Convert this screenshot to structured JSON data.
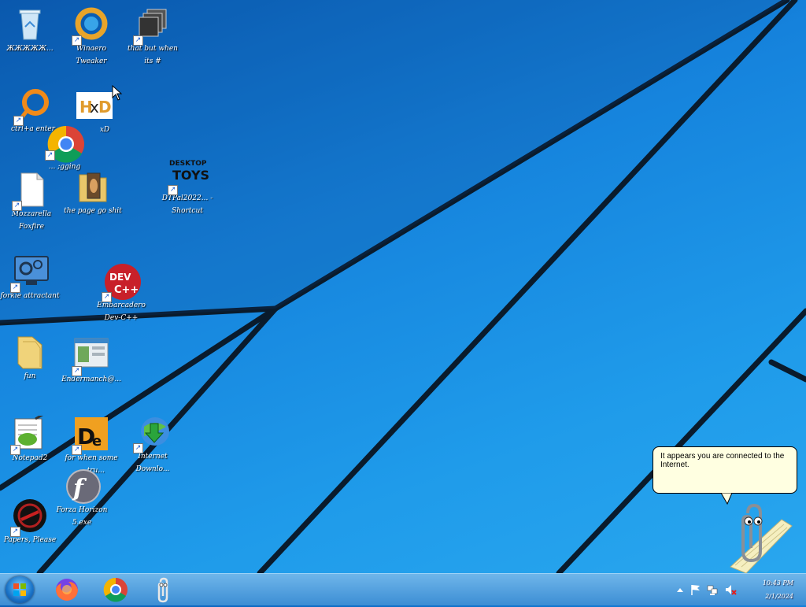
{
  "desktop_icons": [
    {
      "id": "recycle-bin",
      "label": "ЖЖЖЖЖ..."
    },
    {
      "id": "winaero",
      "label": "Winaero Tweaker"
    },
    {
      "id": "win-hash",
      "label": "that but when its #"
    },
    {
      "id": "ctrl-enter",
      "label": "ctrl+a enter"
    },
    {
      "id": "hxd",
      "label": "xD"
    },
    {
      "id": "chrome",
      "label": "... ;gging"
    },
    {
      "id": "desktoptoys",
      "label": "DTPal2022... - Shortcut"
    },
    {
      "id": "mozilla",
      "label": "Mozzarella Foxfire"
    },
    {
      "id": "the-page",
      "label": "the page go shit"
    },
    {
      "id": "forkie",
      "label": "forkie attractant"
    },
    {
      "id": "devcpp",
      "label": "Embarcadero Dev-C++"
    },
    {
      "id": "fun",
      "label": "fun"
    },
    {
      "id": "enderman",
      "label": "Endermanch@..."
    },
    {
      "id": "notepad2",
      "label": "Notepad2"
    },
    {
      "id": "de",
      "label": "for when some ... tru..."
    },
    {
      "id": "idm",
      "label": "Internet Downlo..."
    },
    {
      "id": "flash",
      "label": "Forza Horizon 5.exe"
    },
    {
      "id": "papers",
      "label": "Papers, Please"
    }
  ],
  "taskbar": {
    "pinned": [
      "firefox",
      "chrome",
      "clippy"
    ],
    "clock_time": "10:43 PM",
    "clock_date": "2/1/2024"
  },
  "clippy": {
    "balloon_text": "It appears you are connected to the Internet."
  },
  "colors": {
    "taskbar": "#3c8ed4",
    "balloon": "#ffffe1",
    "wallpaper": "#1f9bea"
  }
}
